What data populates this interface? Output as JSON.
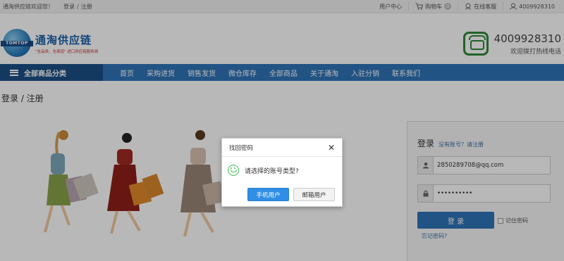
{
  "topbar": {
    "welcome": "通淘供应链欢迎您！",
    "login": "登录",
    "divider": "/",
    "register": "注册",
    "user_center": "用户中心",
    "cart": "购物车",
    "cart_count": "0",
    "online_service": "在线客服",
    "phone": "4009928310"
  },
  "header": {
    "logo_band": "TOMTOP",
    "logo_title": "通淘供应链",
    "logo_sub": "\"全品类、全渠道\" 进口供应链服务商",
    "hotline_number": "4009928310",
    "hotline_text": "欢迎拨打热线电话"
  },
  "nav": {
    "all_categories": "全部商品分类",
    "items": [
      "首页",
      "采购进货",
      "销售发货",
      "微仓库存",
      "全部商品",
      "关于通淘",
      "入驻分销",
      "联系我们"
    ]
  },
  "page": {
    "title": "登录 / 注册"
  },
  "login": {
    "heading": "登录",
    "register_prompt": "没有账号？请注册",
    "username": "2850289708@qq.com",
    "password": "••••••••••",
    "submit": "登 录",
    "remember": "记住密码",
    "forgot": "忘记密码?"
  },
  "modal": {
    "title": "找回密码",
    "close": "✕",
    "message": "请选择的账号类型?",
    "btn_phone": "手机用户",
    "btn_email": "邮箱用户"
  },
  "colors": {
    "brand_blue": "#2e73b8",
    "nav_dark": "#1d4f86",
    "modal_primary": "#2f8ee5",
    "smile_green": "#3fbf55"
  }
}
